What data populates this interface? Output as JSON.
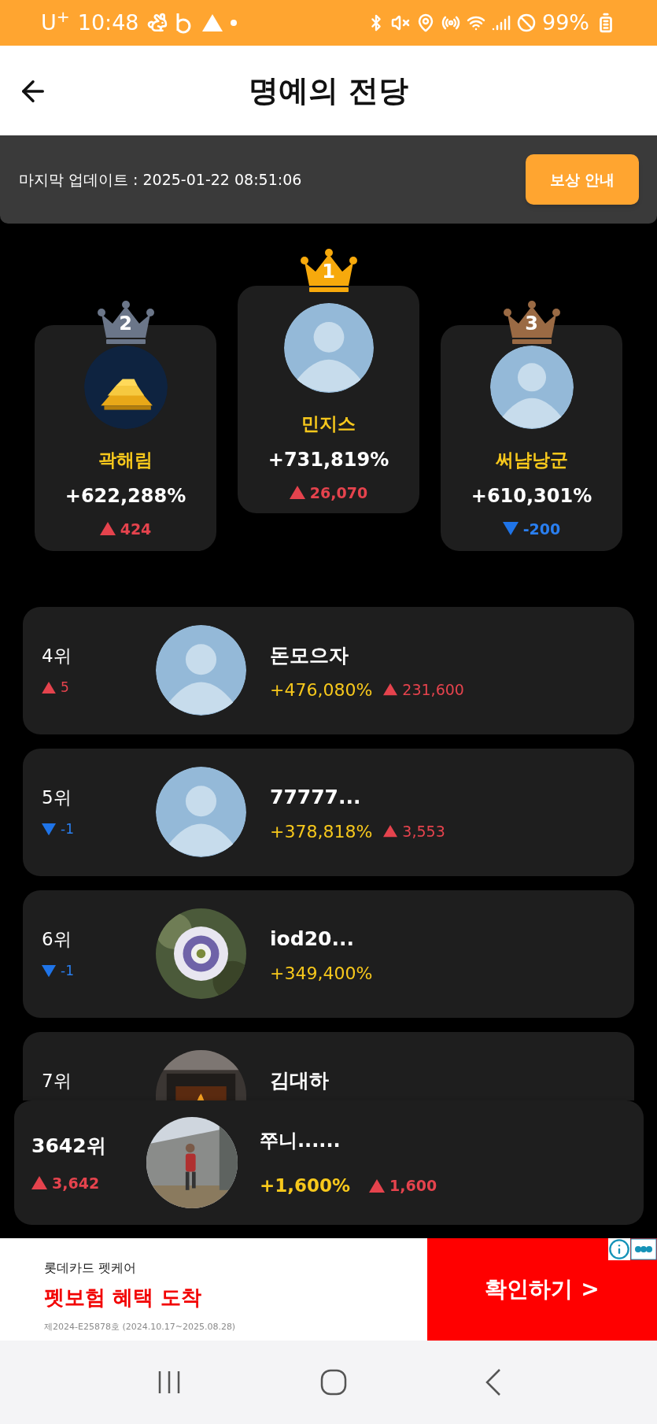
{
  "status_bar": {
    "carrier": "U$^{+}$",
    "time": "10:48",
    "battery": "99%"
  },
  "header": {
    "title": "명예의 전당"
  },
  "update_bar": {
    "text": "마지막 업데이트 : 2025-01-22 08:51:06",
    "button": "보상 안내"
  },
  "podium": [
    {
      "kind": "side",
      "rank": "2",
      "color": "#6b7689",
      "name": "곽해림",
      "percent": "+622,288%",
      "change": {
        "kind": "up",
        "text": "424"
      },
      "avatar": {
        "kind": "gold"
      }
    },
    {
      "kind": "center",
      "rank": "1",
      "color": "#f7a90c",
      "name": "민지스",
      "percent": "+731,819%",
      "change": {
        "kind": "up",
        "text": "26,070"
      },
      "avatar": {
        "kind": "default"
      }
    },
    {
      "kind": "side",
      "rank": "3",
      "color": "#9a6a44",
      "name": "써냠낭군",
      "percent": "+610,301%",
      "change": {
        "kind": "down",
        "text": "-200"
      },
      "avatar": {
        "kind": "default"
      }
    }
  ],
  "rows": [
    {
      "rank": "4위",
      "rank_change": {
        "kind": "up",
        "text": "5"
      },
      "name": "돈모으자",
      "percent": "+476,080%",
      "score_change": {
        "kind": "up",
        "text": "231,600"
      },
      "avatar": {
        "kind": "default"
      }
    },
    {
      "rank": "5위",
      "rank_change": {
        "kind": "down",
        "text": "-1"
      },
      "name": "77777...",
      "percent": "+378,818%",
      "score_change": {
        "kind": "up",
        "text": "3,553"
      },
      "avatar": {
        "kind": "default"
      }
    },
    {
      "rank": "6위",
      "rank_change": {
        "kind": "down",
        "text": "-1"
      },
      "name": "iod20...",
      "percent": "+349,400%",
      "avatar": {
        "kind": "flower"
      }
    },
    {
      "rank": "7위",
      "name": "김대하",
      "avatar": {
        "kind": "fire"
      }
    }
  ],
  "my_rank": {
    "rank": "3642위",
    "rank_change": {
      "kind": "up",
      "text": "3,642"
    },
    "name": "쭈니......",
    "percent": "+1,600%",
    "score_change": {
      "kind": "up",
      "text": "1,600"
    },
    "avatar": {
      "kind": "runner"
    }
  },
  "ad": {
    "brand": "롯데카드 펫케어",
    "headline": "펫보험 혜택 도착",
    "fine_print": "제2024-E25878호 (2024.10.17~2025.08.28)",
    "cta": "확인하기 >"
  }
}
